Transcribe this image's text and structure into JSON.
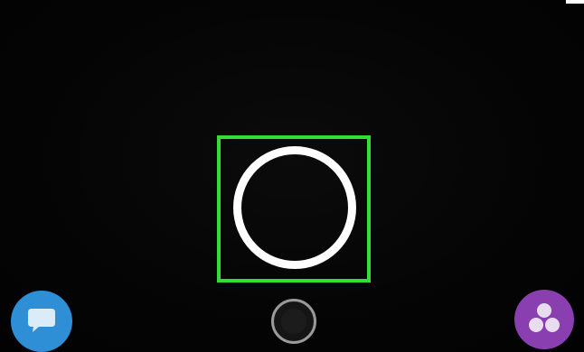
{
  "colors": {
    "background": "#050505",
    "highlight": "#33dd33",
    "capture_ring": "#ffffff",
    "chat_button": "#2f8fd6",
    "stories_button": "#8a3fb0",
    "memories_ring": "#9a9a9a"
  },
  "icons": {
    "capture": "capture-circle-icon",
    "chat": "chat-bubble-icon",
    "memories": "memories-icon",
    "stories": "stories-dots-icon"
  }
}
